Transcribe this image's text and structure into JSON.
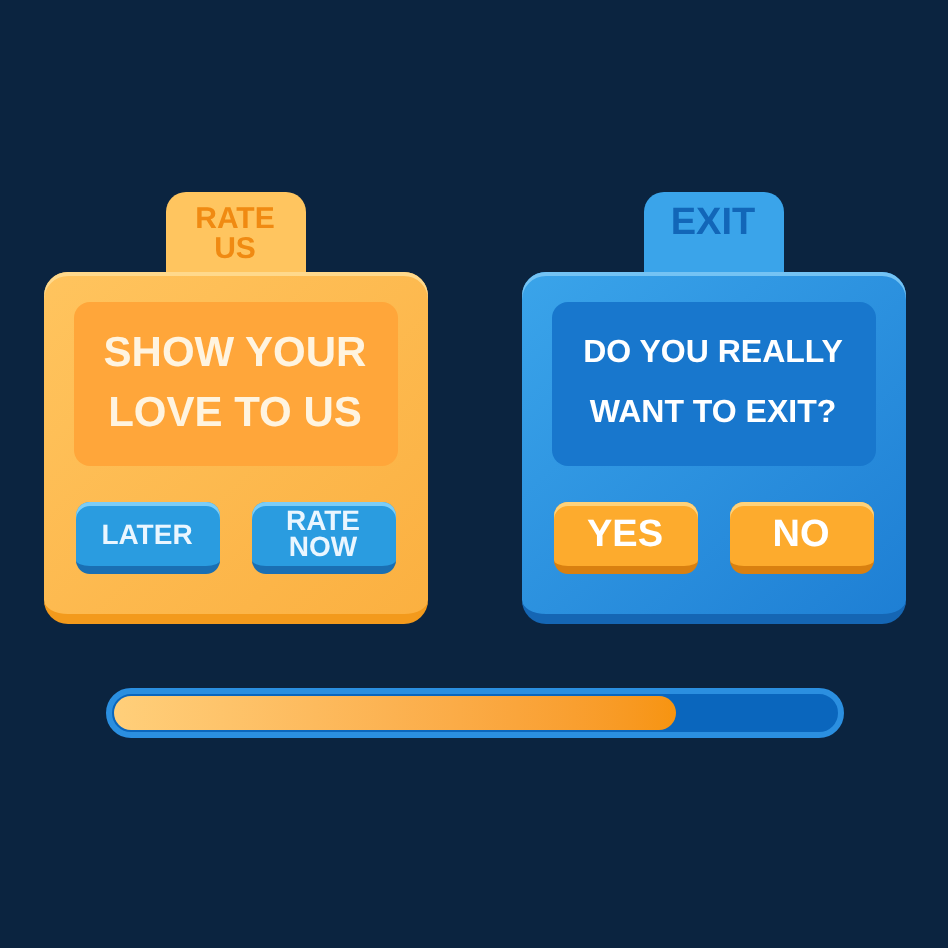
{
  "dialogs": [
    {
      "kind": "orange",
      "tab": "RATE US",
      "message": "SHOW YOUR LOVE TO US",
      "buttons": [
        "LATER",
        "RATE NOW"
      ]
    },
    {
      "kind": "blue",
      "tab": "EXIT",
      "message": "DO YOU REALLY WANT TO EXIT?",
      "buttons": [
        "YES",
        "NO"
      ]
    }
  ],
  "progress": {
    "level": 0.78
  }
}
